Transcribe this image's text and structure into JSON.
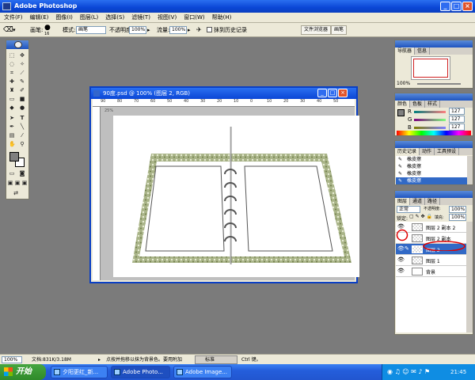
{
  "window": {
    "title": "Adobe Photoshop",
    "btn_min": "_",
    "btn_max": "□",
    "btn_close": "×"
  },
  "menu": [
    "文件(F)",
    "编辑(E)",
    "图像(I)",
    "图层(L)",
    "选择(S)",
    "滤镜(T)",
    "视图(V)",
    "窗口(W)",
    "帮助(H)"
  ],
  "options": {
    "brush_label": "画笔:",
    "brush_size": "16",
    "mode_label": "模式:",
    "mode_value": "画笔",
    "opacity_label": "不透明度:",
    "opacity_value": "100%",
    "flow_label": "流量:",
    "flow_value": "100%",
    "history_label": "抹到历史记录",
    "dock_tab1": "文件浏览器",
    "dock_tab2": "画笔"
  },
  "document": {
    "title": "90度.psd @ 100% (图层 2, RGB)",
    "zoom_tab": "25%"
  },
  "ruler_ticks": [
    "90",
    "80",
    "70",
    "60",
    "50",
    "40",
    "30",
    "20",
    "10",
    "0",
    "10",
    "20",
    "30",
    "40",
    "50"
  ],
  "navigator": {
    "tabs": [
      "导航器",
      "信息"
    ],
    "zoom": "100%"
  },
  "color": {
    "tabs": [
      "颜色",
      "色板",
      "样式"
    ],
    "r_label": "R",
    "g_label": "G",
    "b_label": "B",
    "r": "127",
    "g": "127",
    "b": "127"
  },
  "history": {
    "tabs": [
      "历史记录",
      "动作",
      "工具预设"
    ],
    "items": [
      "橡皮擦",
      "橡皮擦",
      "橡皮擦",
      "橡皮擦"
    ]
  },
  "layers": {
    "tabs": [
      "图层",
      "通道",
      "路径"
    ],
    "blend": "正常",
    "opacity_label": "不透明度:",
    "opacity": "100%",
    "lock_label": "锁定:",
    "fill_label": "填充:",
    "fill": "100%",
    "items": [
      {
        "name": "图层 2 副本 2",
        "visible": true
      },
      {
        "name": "图层 2 副本",
        "visible": false
      },
      {
        "name": "图层 2",
        "visible": true,
        "selected": true
      },
      {
        "name": "图层 1",
        "visible": true
      },
      {
        "name": "背景",
        "visible": true
      }
    ]
  },
  "status": {
    "zoom": "100%",
    "doc": "文档:831K/3.18M",
    "hint": "点按并拖移以抹为背景色。要用附加",
    "hint_end": "Ctrl 键。",
    "style_btn": "标准"
  },
  "taskbar": {
    "start": "开始",
    "buttons": [
      "夕阳更红_新...",
      "Adobe Photo...",
      "Adobe Image..."
    ],
    "clock": "21:45"
  },
  "colors": {
    "accent": "#0a46d6",
    "selection_circle": "#e00000",
    "layer_selected": "#3169c6"
  }
}
